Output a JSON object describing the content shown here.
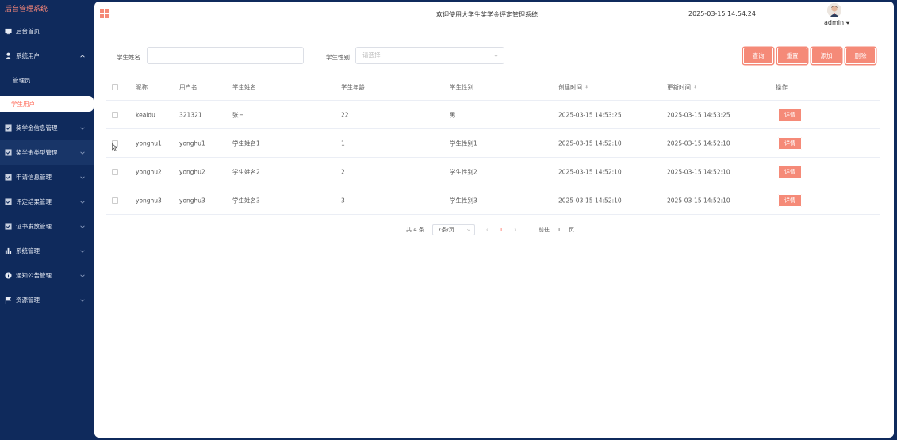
{
  "sidebar": {
    "brand": "后台管理系统",
    "items": [
      {
        "label": "后台首页",
        "icon": "monitor-icon"
      },
      {
        "label": "系统用户",
        "icon": "user-icon",
        "expanded": true
      },
      {
        "label": "管理员"
      },
      {
        "label": "学生用户",
        "active": true
      },
      {
        "label": "奖学金信息管理",
        "icon": "check-square-icon"
      },
      {
        "label": "奖学金类型管理",
        "icon": "check-square-icon"
      },
      {
        "label": "申请信息管理",
        "icon": "check-square-icon"
      },
      {
        "label": "评定结果管理",
        "icon": "check-square-icon"
      },
      {
        "label": "证书发放管理",
        "icon": "check-square-icon"
      },
      {
        "label": "系统管理",
        "icon": "bar-chart-icon"
      },
      {
        "label": "通知公告管理",
        "icon": "info-circle-icon"
      },
      {
        "label": "资源管理",
        "icon": "flag-icon"
      }
    ]
  },
  "header": {
    "welcome": "欢迎使用大学生奖学金评定管理系统",
    "datetime": "2025-03-15 14:54:24",
    "username": "admin"
  },
  "search": {
    "name_label": "学生姓名",
    "name_value": "",
    "gender_label": "学生性别",
    "gender_placeholder": "请选择",
    "buttons": {
      "query": "查询",
      "reset": "重置",
      "add": "添加",
      "delete": "删除"
    }
  },
  "table": {
    "headers": [
      "昵称",
      "用户名",
      "学生姓名",
      "学生年龄",
      "学生性别",
      "创建时间",
      "更新时间",
      "操作"
    ],
    "rows": [
      {
        "nickname": "keaidu",
        "username": "321321",
        "name": "张三",
        "age": "22",
        "gender": "男",
        "created": "2025-03-15 14:53:25",
        "updated": "2025-03-15 14:53:25",
        "action": "详情"
      },
      {
        "nickname": "yonghu1",
        "username": "yonghu1",
        "name": "学生姓名1",
        "age": "1",
        "gender": "学生性别1",
        "created": "2025-03-15 14:52:10",
        "updated": "2025-03-15 14:52:10",
        "action": "详情"
      },
      {
        "nickname": "yonghu2",
        "username": "yonghu2",
        "name": "学生姓名2",
        "age": "2",
        "gender": "学生性别2",
        "created": "2025-03-15 14:52:10",
        "updated": "2025-03-15 14:52:10",
        "action": "详情"
      },
      {
        "nickname": "yonghu3",
        "username": "yonghu3",
        "name": "学生姓名3",
        "age": "3",
        "gender": "学生性别3",
        "created": "2025-03-15 14:52:10",
        "updated": "2025-03-15 14:52:10",
        "action": "详情"
      }
    ]
  },
  "pagination": {
    "total": "共 4 条",
    "page_size": "7条/页",
    "current_page": "1",
    "goto_label": "前往",
    "goto_value": "1",
    "page_unit": "页"
  },
  "colors": {
    "sidebar_bg": "#0f2a5c",
    "accent": "#f58a78",
    "active_text": "#ff6b5a"
  }
}
